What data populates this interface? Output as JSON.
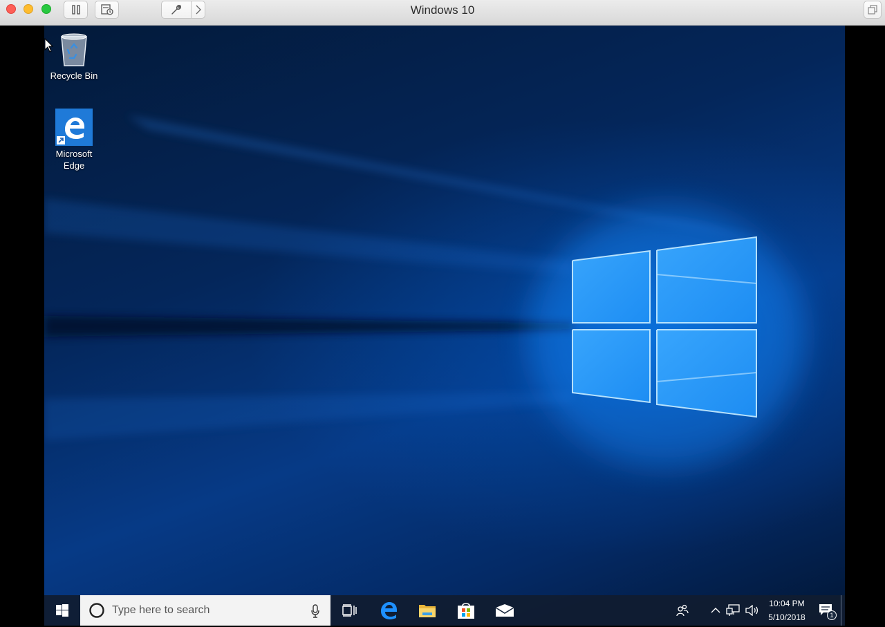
{
  "window": {
    "title": "Windows 10"
  },
  "desktop": {
    "icons": [
      {
        "label": "Recycle Bin",
        "icon": "recycle-bin-icon"
      },
      {
        "label": "Microsoft Edge",
        "icon": "edge-icon"
      }
    ]
  },
  "taskbar": {
    "search_placeholder": "Type here to search",
    "apps": [
      "task-view-icon",
      "edge-icon",
      "file-explorer-icon",
      "store-icon",
      "mail-icon"
    ],
    "clock": {
      "time": "10:04 PM",
      "date": "5/10/2018"
    },
    "notification_count": "1"
  },
  "colors": {
    "accent": "#0078d7",
    "taskbar": "#101c30",
    "wallpaper_dark": "#031a3a"
  }
}
